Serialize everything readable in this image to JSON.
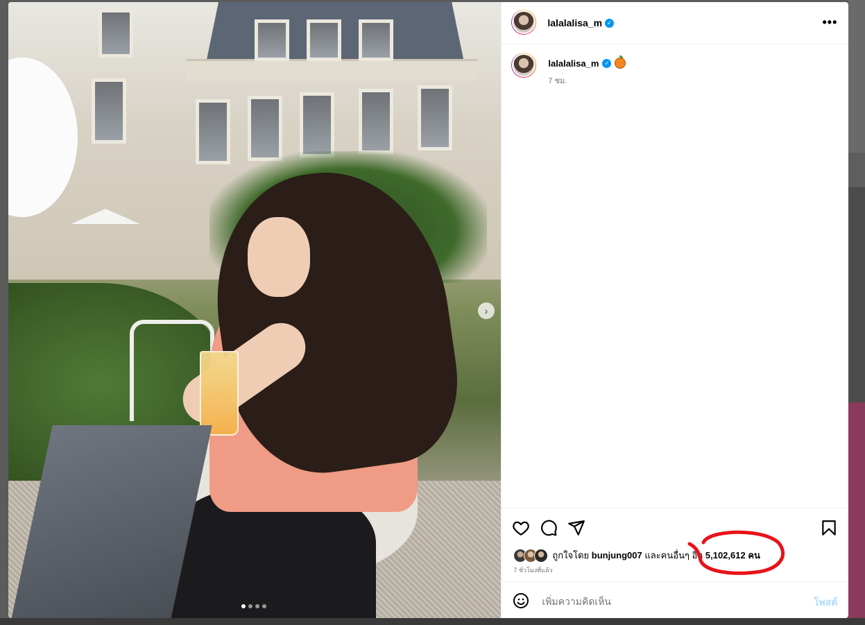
{
  "post": {
    "username": "lalalalisa_m",
    "more_icon": "•••",
    "next_icon": "›",
    "photo_count": 4,
    "active_photo": 1
  },
  "caption": {
    "username": "lalalalisa_m",
    "time": "7 ชม."
  },
  "likes": {
    "prefix": "ถูกใจโดย",
    "user": "bunjung007",
    "middle": "และคนอื่นๆ อีก",
    "count": "5,102,612",
    "suffix": "คน"
  },
  "post_time": "7 ชั่วโมงที่แล้ว",
  "comment": {
    "placeholder": "เพิ่มความคิดเห็น",
    "post_label": "โพสต์"
  },
  "colors": {
    "verified": "#0095f6",
    "annotation": "#e8121a",
    "post_disabled": "#b3dbff"
  }
}
